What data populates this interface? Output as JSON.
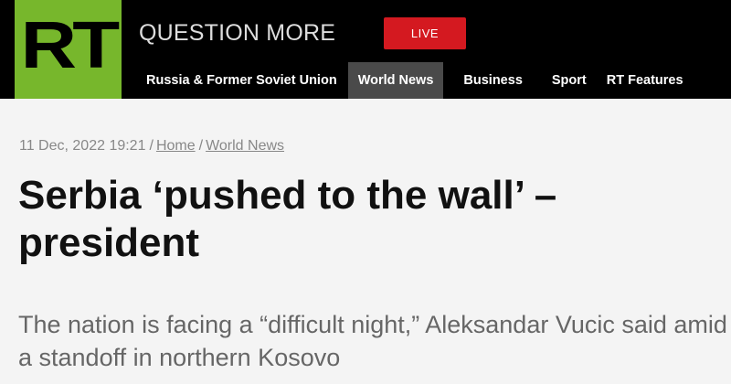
{
  "header": {
    "logo_text": "RT",
    "tagline": "QUESTION MORE",
    "live_label": "LIVE",
    "nav": [
      {
        "label": "Russia & Former Soviet Union",
        "active": false
      },
      {
        "label": "World News",
        "active": true
      },
      {
        "label": "Business",
        "active": false
      },
      {
        "label": "Sport",
        "active": false
      },
      {
        "label": "RT Features",
        "active": false
      }
    ]
  },
  "article": {
    "date": "11 Dec, 2022 19:21",
    "breadcrumb": [
      "Home",
      "World News"
    ],
    "title": "Serbia ‘pushed to the wall’ – president",
    "summary": "The nation is facing a “difficult night,” Aleksandar Vucic said amid a standoff in northern Kosovo"
  },
  "colors": {
    "brand_green": "#77b72c",
    "live_red": "#d41920",
    "header_bg": "#000000",
    "active_nav_bg": "#4a4a4a"
  }
}
